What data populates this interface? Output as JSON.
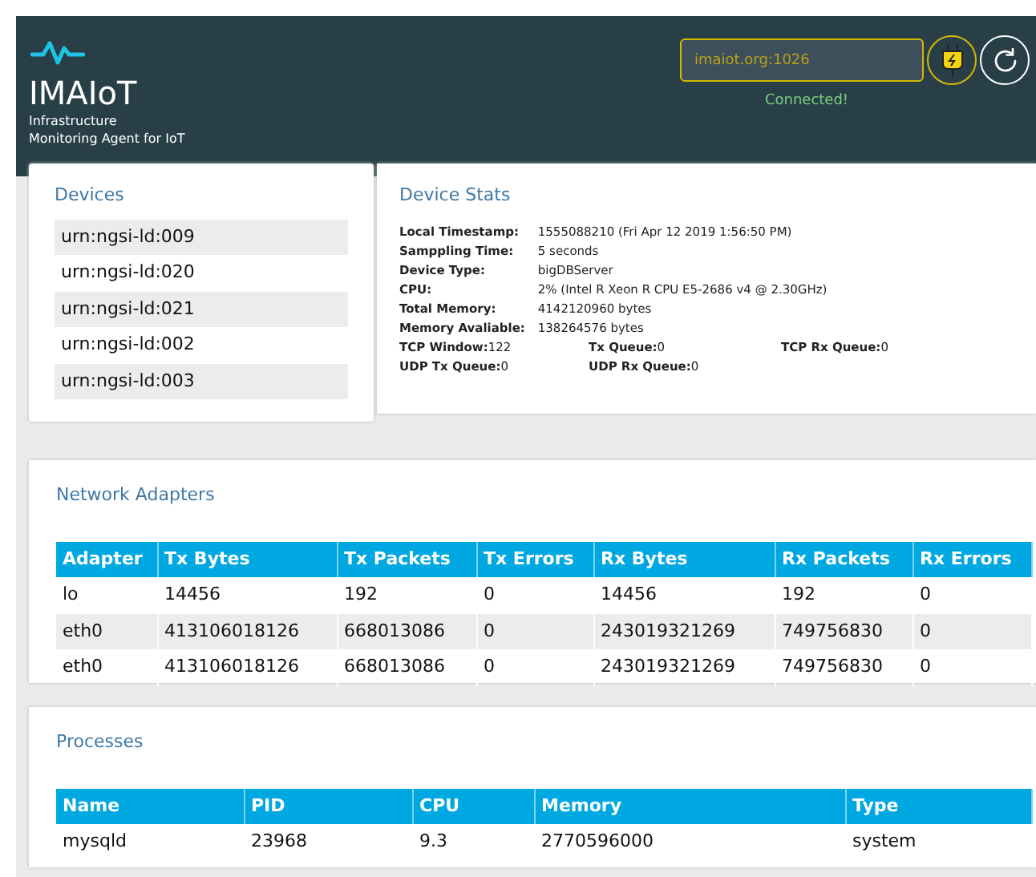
{
  "header": {
    "title": "IMAIoT",
    "subtitle_lines": [
      "Infrastructure",
      "Monitoring Agent for IoT"
    ],
    "server_field": {
      "value": "imaiot.org:1026"
    },
    "status": "Connected!"
  },
  "devices": {
    "title": "Devices",
    "items": [
      "urn:ngsi-ld:009",
      "urn:ngsi-ld:020",
      "urn:ngsi-ld:021",
      "urn:ngsi-ld:002",
      "urn:ngsi-ld:003"
    ]
  },
  "device_stats": {
    "title": "Device Stats",
    "lines": [
      [
        {
          "label": "Local Timestamp:",
          "value": "1555088210 (Fri Apr 12 2019 1:56:50 PM)"
        }
      ],
      [
        {
          "label": "Samppling Time:",
          "value": "5 seconds"
        }
      ],
      [
        {
          "label": "Device Type:",
          "value": "bigDBServer"
        }
      ],
      [
        {
          "label": "CPU:",
          "value": "2% (Intel R Xeon R CPU E5-2686 v4 @ 2.30GHz)"
        }
      ],
      [
        {
          "label": "Total Memory:",
          "value": "4142120960 bytes"
        }
      ],
      [
        {
          "label": "Memory Avaliable:",
          "value": "138264576 bytes"
        }
      ],
      [
        {
          "label": "TCP Window:",
          "value": "122"
        },
        {
          "label": "Tx Queue:",
          "value": "0"
        },
        {
          "label": "TCP Rx Queue:",
          "value": "0"
        }
      ],
      [
        {
          "label": "UDP Tx Queue:",
          "value": "0"
        },
        {
          "label": "UDP Rx Queue:",
          "value": "0"
        }
      ]
    ]
  },
  "network_adapters": {
    "title": "Network Adapters",
    "columns": [
      "Adapter",
      "Tx Bytes",
      "Tx Packets",
      "Tx Errors",
      "Rx Bytes",
      "Rx Packets",
      "Rx Errors"
    ],
    "rows": [
      [
        "lo",
        "14456",
        "192",
        "0",
        "14456",
        "192",
        "0"
      ],
      [
        "eth0",
        "413106018126",
        "668013086",
        "0",
        "243019321269",
        "749756830",
        "0"
      ],
      [
        "eth0",
        "413106018126",
        "668013086",
        "0",
        "243019321269",
        "749756830",
        "0"
      ]
    ]
  },
  "processes": {
    "title": "Processes",
    "columns": [
      "Name",
      "PID",
      "CPU",
      "Memory",
      "Type"
    ],
    "rows": [
      [
        "mysqld",
        "23968",
        "9.3",
        "2770596000",
        "system"
      ]
    ]
  }
}
